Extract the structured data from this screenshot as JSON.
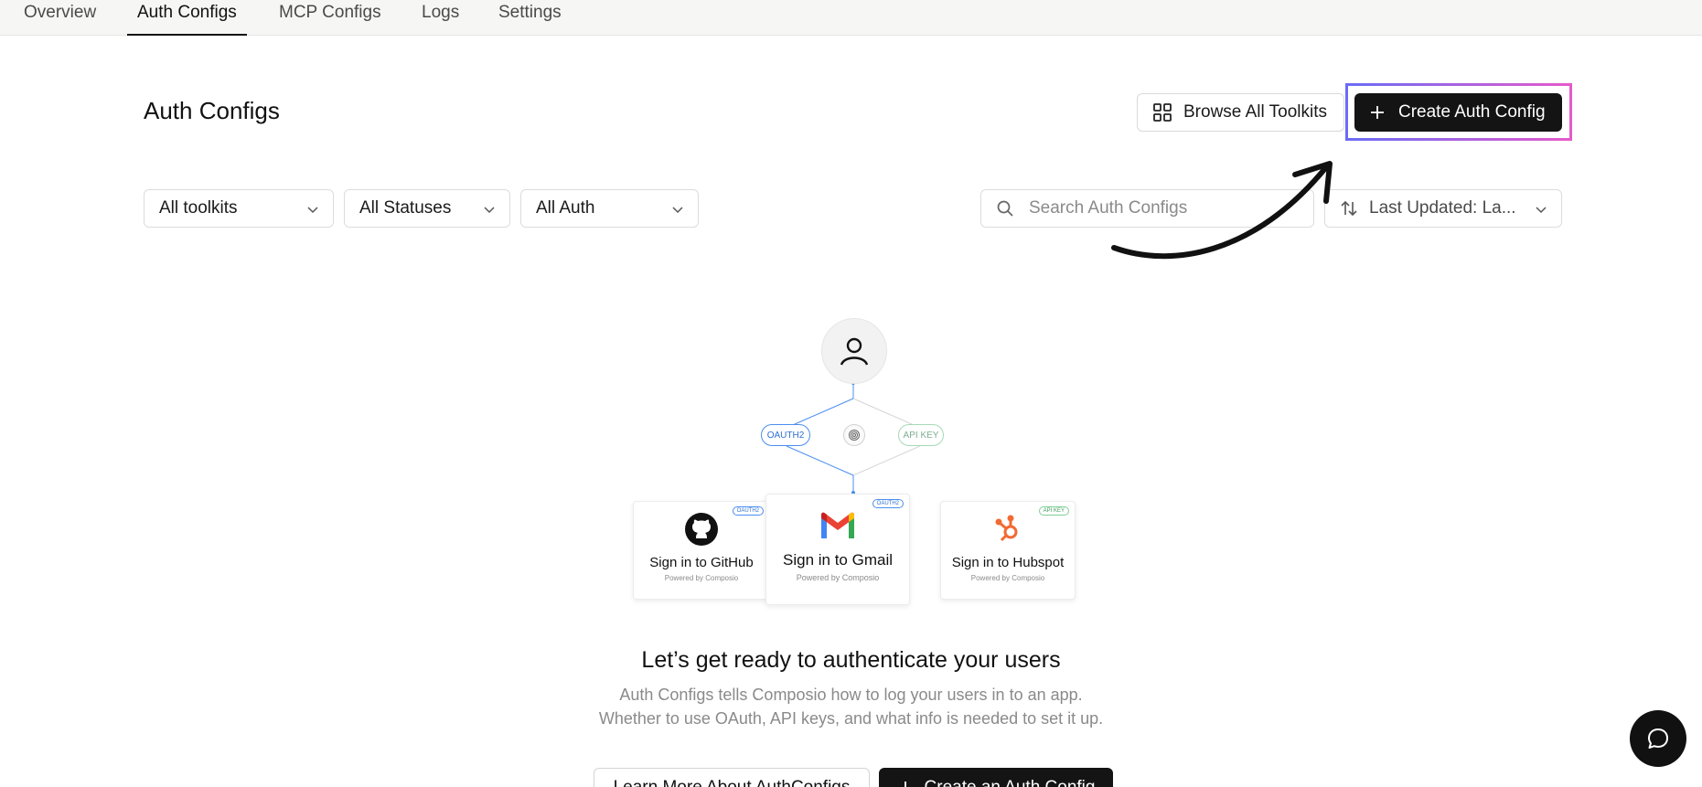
{
  "nav": {
    "tabs": [
      {
        "label": "Overview"
      },
      {
        "label": "Auth Configs"
      },
      {
        "label": "MCP Configs"
      },
      {
        "label": "Logs"
      },
      {
        "label": "Settings"
      }
    ],
    "active_tab": "Auth Configs"
  },
  "header": {
    "title": "Auth Configs",
    "browse_label": "Browse All Toolkits",
    "create_label": "Create Auth Config"
  },
  "filters": {
    "toolkits": "All toolkits",
    "statuses": "All Statuses",
    "auth": "All Auth",
    "search_placeholder": "Search Auth Configs",
    "sort": "Last Updated: La..."
  },
  "illustration": {
    "oauth_pill": "OAUTH2",
    "api_pill": "API KEY",
    "cards": [
      {
        "title": "Sign in to GitHub",
        "sub": "Powered by Composio",
        "tag": "OAUTH2"
      },
      {
        "title": "Sign in to Gmail",
        "sub": "Powered by Composio",
        "tag": "OAUTH2"
      },
      {
        "title": "Sign in to Hubspot",
        "sub": "Powered by Composio",
        "tag": "API KEY"
      }
    ]
  },
  "empty_state": {
    "headline": "Let’s get ready to authenticate your users",
    "line1": "Auth Configs tells Composio how to log your users in to an app.",
    "line2": "Whether to use OAuth, API keys, and what info is needed to set it up.",
    "learn_more": "Learn More About AuthConfigs",
    "create": "Create an Auth Config"
  },
  "colors": {
    "primary_dark": "#141414",
    "highlight_start": "#6a6cf5",
    "highlight_end": "#e55acb",
    "oauth_blue": "#4a8ff0",
    "api_green": "#7fcf95"
  },
  "icons": {
    "browse": "grid-icon",
    "create": "plus-icon",
    "search": "search-icon",
    "sort": "sort-arrows-icon",
    "chat": "chat-bubble-icon",
    "avatar": "user-icon",
    "center": "fingerprint-icon"
  }
}
